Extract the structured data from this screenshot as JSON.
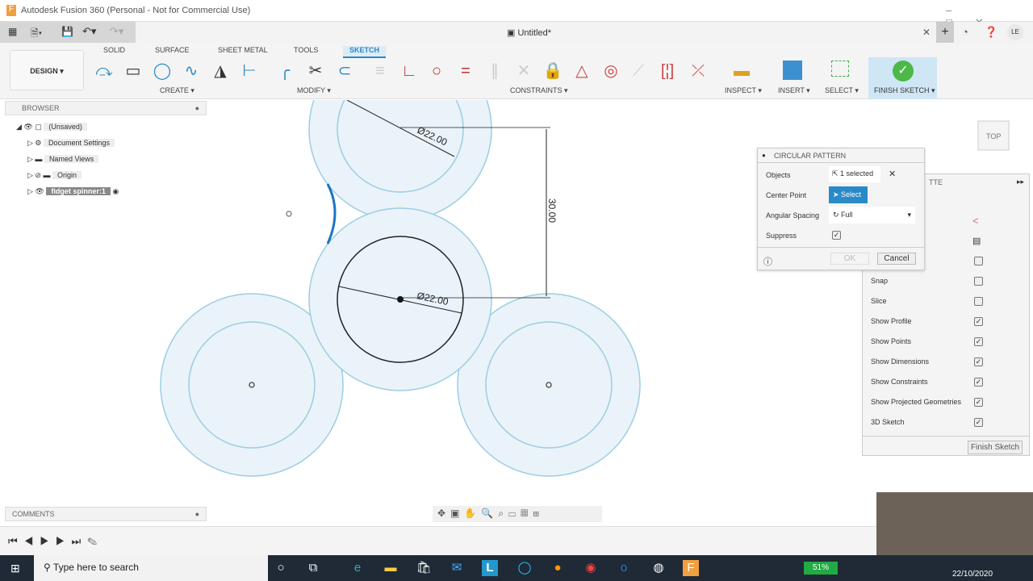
{
  "window": {
    "title": "Autodesk Fusion 360 (Personal - Not for Commercial Use)",
    "doc_tab": "Untitled*",
    "user": "LE"
  },
  "ribbon": {
    "workspace": "DESIGN ▾",
    "tabs": [
      "SOLID",
      "SURFACE",
      "SHEET METAL",
      "TOOLS",
      "SKETCH"
    ],
    "active_tab": "SKETCH",
    "groups": {
      "create": "CREATE ▾",
      "modify": "MODIFY ▾",
      "constraints": "CONSTRAINTS ▾",
      "inspect": "INSPECT ▾",
      "insert": "INSERT ▾",
      "select": "SELECT ▾",
      "finish": "FINISH SKETCH ▾"
    }
  },
  "browser": {
    "title": "BROWSER",
    "items": [
      {
        "label": "(Unsaved)"
      },
      {
        "label": "Document Settings"
      },
      {
        "label": "Named Views"
      },
      {
        "label": "Origin"
      },
      {
        "label": "fidget spinner:1"
      }
    ]
  },
  "canvas": {
    "dim_top": "Ø22.00",
    "dim_center": "Ø22.00",
    "dim_vertical": "30.00",
    "viewcube": "TOP"
  },
  "dialog": {
    "title": "CIRCULAR PATTERN",
    "objects_label": "Objects",
    "objects_value": "1 selected",
    "center_label": "Center Point",
    "center_value": "Select",
    "spacing_label": "Angular Spacing",
    "spacing_value": "Full",
    "suppress_label": "Suppress",
    "suppress_checked": true,
    "ok": "OK",
    "cancel": "Cancel"
  },
  "palette": {
    "title": "TTE",
    "items": [
      {
        "label": "Snap",
        "checked": false
      },
      {
        "label": "Slice",
        "checked": false
      },
      {
        "label": "Show Profile",
        "checked": true
      },
      {
        "label": "Show Points",
        "checked": true
      },
      {
        "label": "Show Dimensions",
        "checked": true
      },
      {
        "label": "Show Constraints",
        "checked": true
      },
      {
        "label": "Show Projected Geometries",
        "checked": true
      },
      {
        "label": "3D Sketch",
        "checked": true
      }
    ],
    "finish": "Finish Sketch"
  },
  "comments": {
    "title": "COMMENTS"
  },
  "taskbar": {
    "search_placeholder": "Type here to search",
    "battery": "51%",
    "date": "22/10/2020"
  },
  "colors": {
    "accent": "#2a8ac8",
    "profile_fill": "#eaf3f9",
    "profile_stroke": "#9ccde3",
    "finish_green": "#4cb848"
  }
}
